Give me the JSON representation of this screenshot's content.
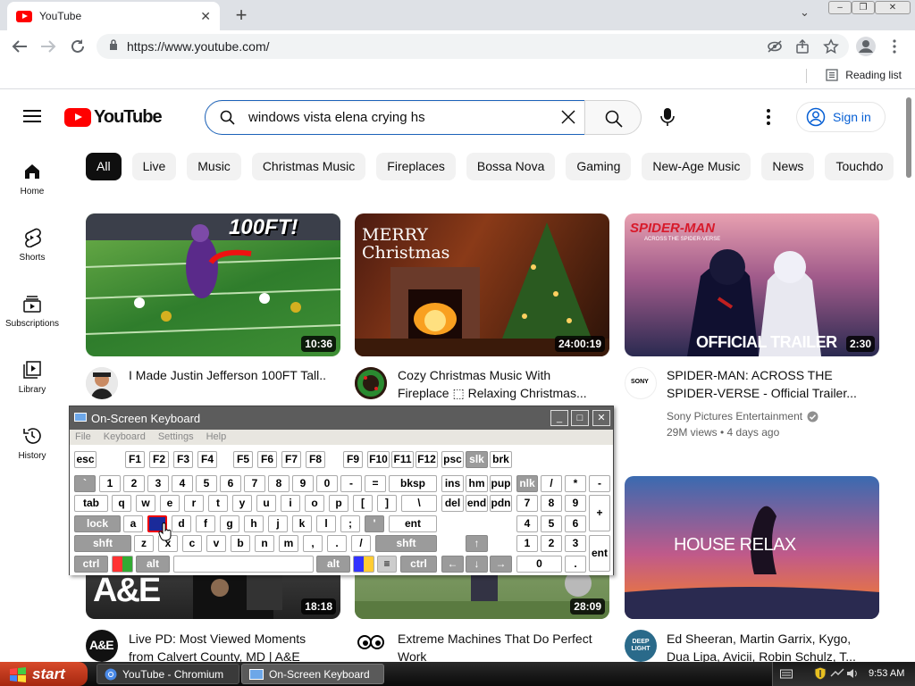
{
  "browser": {
    "tab_title": "YouTube",
    "tab_close": "✕",
    "new_tab": "+",
    "tab_menu": "⌄",
    "url": "https://www.youtube.com/",
    "reading_list": "Reading list",
    "window_controls": [
      "‒",
      "❐",
      "✕"
    ]
  },
  "youtube": {
    "logo_text": "YouTube",
    "search_query": "windows vista elena crying hs",
    "sign_in": "Sign in",
    "chips": [
      "All",
      "Live",
      "Music",
      "Christmas Music",
      "Fireplaces",
      "Bossa Nova",
      "Gaming",
      "New-Age Music",
      "News",
      "Touchdo"
    ],
    "guide": [
      {
        "label": "Home",
        "icon": "home-icon"
      },
      {
        "label": "Shorts",
        "icon": "shorts-icon"
      },
      {
        "label": "Subscriptions",
        "icon": "subscriptions-icon"
      },
      {
        "label": "Library",
        "icon": "library-icon"
      },
      {
        "label": "History",
        "icon": "history-icon"
      }
    ],
    "videos": [
      {
        "title": "I Made Justin Jefferson 100FT Tall..",
        "duration": "10:36",
        "thumb_text": "100FT!",
        "channel": "",
        "meta": ""
      },
      {
        "title": "Cozy Christmas Music With Fireplace ⬚ Relaxing Christmas...",
        "duration": "24:00:19",
        "thumb_text": "MERRY Christmas",
        "channel": "",
        "meta": ""
      },
      {
        "title": "SPIDER-MAN: ACROSS THE SPIDER-VERSE - Official Trailer...",
        "duration": "2:30",
        "thumb_text": "OFFICIAL TRAILER",
        "channel": "Sony Pictures Entertainment",
        "meta": "29M views • 4 days ago"
      },
      {
        "title": "Live PD: Most Viewed Moments from Calvert County, MD | A&E",
        "duration": "18:18",
        "thumb_text": "A&E",
        "channel": "",
        "meta": ""
      },
      {
        "title": "Extreme Machines That Do Perfect Work",
        "duration": "28:09",
        "thumb_text": "",
        "channel": "",
        "meta": ""
      },
      {
        "title": "Ed Sheeran, Martin Garrix, Kygo, Dua Lipa, Avicii, Robin Schulz, T...",
        "duration": "",
        "thumb_text": "HOUSE RELAX",
        "channel": "",
        "meta": ""
      }
    ],
    "spider_logo": "SPIDER-MAN",
    "spider_sub": "ACROSS THE SPIDER-VERSE",
    "sony_avatar": "SONY",
    "deep_avatar": "DEEP LIGHT"
  },
  "osk": {
    "title": "On-Screen Keyboard",
    "menu": [
      "File",
      "Keyboard",
      "Settings",
      "Help"
    ],
    "title_buttons": [
      "_",
      "□",
      "✕"
    ]
  },
  "taskbar": {
    "start": "start",
    "tasks": [
      "YouTube - Chromium",
      "On-Screen Keyboard"
    ],
    "clock": "9:53 AM"
  }
}
